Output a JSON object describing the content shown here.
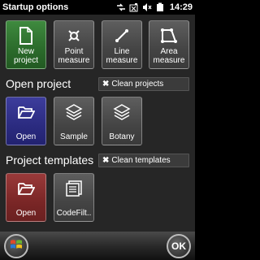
{
  "statusbar": {
    "title": "Startup options",
    "time": "14:29",
    "icons": [
      "connectivity-icon",
      "no-signal-icon",
      "volume-muted-icon",
      "battery-icon"
    ]
  },
  "top_tiles": [
    {
      "label": "New project",
      "icon": "new-document-icon"
    },
    {
      "label": "Point measure",
      "icon": "point-measure-icon"
    },
    {
      "label": "Line measure",
      "icon": "line-measure-icon"
    },
    {
      "label": "Area measure",
      "icon": "area-measure-icon"
    }
  ],
  "open_project": {
    "title": "Open project",
    "clean_label": "Clean projects",
    "tiles": [
      {
        "label": "Open",
        "icon": "open-folder-icon"
      },
      {
        "label": "Sample",
        "icon": "layers-icon"
      },
      {
        "label": "Botany",
        "icon": "layers-icon"
      }
    ]
  },
  "project_templates": {
    "title": "Project templates",
    "clean_label": "Clean templates",
    "tiles": [
      {
        "label": "Open",
        "icon": "open-folder-icon"
      },
      {
        "label": "CodeFilt..",
        "icon": "template-icon"
      }
    ]
  },
  "bottombar": {
    "start_icon": "windows-start-icon",
    "ok_label": "OK"
  },
  "colors": {
    "new_project": "#2b6b2b",
    "open_project": "#2b2b80",
    "open_template": "#7a2626",
    "tile_gray": "#444444",
    "background": "#262626"
  }
}
